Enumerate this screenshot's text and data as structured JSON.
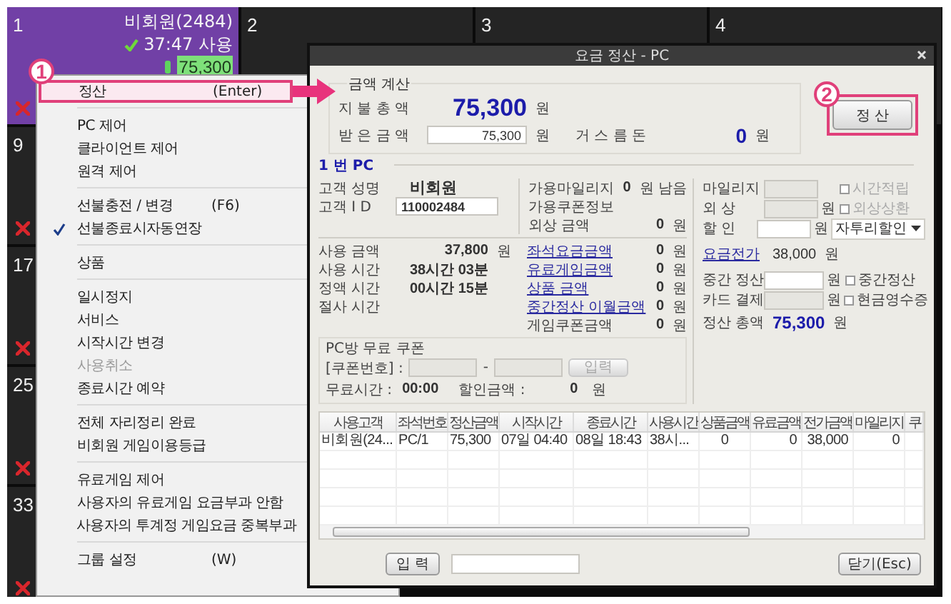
{
  "tile_rows": [
    [
      {
        "number": "1",
        "selected": true,
        "alert": true,
        "customer": "비회원(2484)",
        "time": "37:47 사용",
        "amount": "75,300"
      },
      {
        "number": "2",
        "selected": false
      },
      {
        "number": "3",
        "selected": false
      },
      {
        "number": "4",
        "selected": false
      }
    ],
    [
      {
        "number": "9",
        "selected": false,
        "alert": true
      }
    ],
    [
      {
        "number": "17",
        "selected": false,
        "alert": true
      }
    ],
    [
      {
        "number": "25",
        "selected": false,
        "alert": true
      }
    ],
    [
      {
        "number": "33",
        "selected": false,
        "alert": true
      }
    ]
  ],
  "context_menu": {
    "items": [
      {
        "kind": "item",
        "label": "정산",
        "shortcut": "(Enter)",
        "selected": true,
        "checked": false,
        "disabled": false
      },
      {
        "kind": "separator"
      },
      {
        "kind": "item",
        "label": "PC 제어",
        "selected": false,
        "checked": false,
        "disabled": false
      },
      {
        "kind": "item",
        "label": "클라이언트 제어",
        "selected": false,
        "checked": false,
        "disabled": false
      },
      {
        "kind": "item",
        "label": "원격 제어",
        "selected": false,
        "checked": false,
        "disabled": false
      },
      {
        "kind": "separator"
      },
      {
        "kind": "item",
        "label": "선불충전 / 변경",
        "shortcut": "(F6)",
        "selected": false,
        "checked": false,
        "disabled": false
      },
      {
        "kind": "item",
        "label": "선불종료시자동연장",
        "selected": false,
        "checked": true,
        "disabled": false
      },
      {
        "kind": "separator"
      },
      {
        "kind": "item",
        "label": "상품",
        "selected": false,
        "checked": false,
        "disabled": false
      },
      {
        "kind": "separator"
      },
      {
        "kind": "item",
        "label": "일시정지",
        "selected": false,
        "checked": false,
        "disabled": false
      },
      {
        "kind": "item",
        "label": "서비스",
        "selected": false,
        "checked": false,
        "disabled": false
      },
      {
        "kind": "item",
        "label": "시작시간 변경",
        "selected": false,
        "checked": false,
        "disabled": false
      },
      {
        "kind": "item",
        "label": "사용취소",
        "selected": false,
        "checked": false,
        "disabled": true
      },
      {
        "kind": "item",
        "label": "종료시간 예약",
        "selected": false,
        "checked": false,
        "disabled": false
      },
      {
        "kind": "separator"
      },
      {
        "kind": "item",
        "label": "전체 자리정리 완료",
        "selected": false,
        "checked": false,
        "disabled": false
      },
      {
        "kind": "item",
        "label": "비회원 게임이용등급",
        "selected": false,
        "checked": false,
        "disabled": false
      },
      {
        "kind": "separator"
      },
      {
        "kind": "item",
        "label": "유료게임 제어",
        "selected": false,
        "checked": false,
        "disabled": false
      },
      {
        "kind": "item",
        "label": "사용자의 유료게임 요금부과 안함",
        "selected": false,
        "checked": false,
        "disabled": false
      },
      {
        "kind": "item",
        "label": "사용자의 투계정 게임요금 중복부과",
        "selected": false,
        "checked": false,
        "disabled": false
      },
      {
        "kind": "separator"
      },
      {
        "kind": "item",
        "label": "그룹 설정",
        "shortcut": "(W)",
        "selected": false,
        "checked": false,
        "disabled": false
      }
    ]
  },
  "callouts": [
    {
      "label": "1"
    },
    {
      "label": "2"
    }
  ],
  "dialog": {
    "title": "요금 정산 - PC",
    "amount_group": {
      "legend": "금액 계산",
      "total_label": "지 불 총 액",
      "total": "75,300",
      "total_unit": "원",
      "received_label": "받 은 금 액",
      "received": "75,300",
      "received_unit": "원",
      "change_label": "거 스 름 돈",
      "change": "0",
      "change_unit": "원"
    },
    "settle_button": "정 산",
    "pc_label": "1 번 PC",
    "customer_rows": [
      {
        "kind": "text",
        "label": "고객 성명",
        "value": "비회원"
      },
      {
        "kind": "field",
        "label": "고객 I D",
        "value": "110002484"
      }
    ],
    "balance_rows": [
      {
        "label": "가용마일리지",
        "value": "0",
        "unit": "원 남음"
      },
      {
        "label": "가용쿠폰정보"
      },
      {
        "label": "외상 금액",
        "value": "0",
        "unit": "원"
      }
    ],
    "usage_rows": [
      {
        "label": "사용 금액",
        "value": "37,800",
        "unit": "원"
      },
      {
        "label": "사용 시간",
        "value": "38시간 03분"
      },
      {
        "label": "정액 시간",
        "value": "00시간 15분"
      },
      {
        "label": "절사 시간"
      }
    ],
    "charge_rows": [
      {
        "label": "좌석요금금액",
        "link": true,
        "value": "0",
        "unit": "원"
      },
      {
        "label": "유료게임금액",
        "link": true,
        "value": "0",
        "unit": "원"
      },
      {
        "label": "상품 금액",
        "link": true,
        "value": "0",
        "unit": "원"
      },
      {
        "label": "중간정산 이월금액",
        "link": true,
        "value": "0",
        "unit": "원"
      },
      {
        "label": "게임쿠폰금액",
        "link": false,
        "value": "0",
        "unit": "원"
      }
    ],
    "coupon": {
      "title": "PC방 무료 쿠폰",
      "code_label": "[쿠폰번호] :",
      "dash": "-",
      "enter_button": "입력",
      "enter_disabled": true,
      "free_time_label": "무료시간 :",
      "free_time": "00:00",
      "discount_label": "할인금액 :",
      "discount": "0",
      "discount_unit": "원"
    },
    "side_rows": [
      {
        "kind": "field",
        "label": "마일리지",
        "disabled": true,
        "checkbox": {
          "label": "시간적립",
          "checked": false,
          "disabled": true
        }
      },
      {
        "kind": "field",
        "label": "외 상",
        "unit": "원",
        "disabled": true,
        "checkbox": {
          "label": "외상상환",
          "checked": false,
          "disabled": true
        }
      },
      {
        "kind": "field",
        "label": "할 인",
        "unit": "원",
        "disabled": false,
        "dropdown": "자투리할인"
      },
      {
        "kind": "text",
        "label": "요금전가",
        "link": true,
        "value": "38,000",
        "unit": "원"
      },
      {
        "kind": "field",
        "label": "중간 정산",
        "unit": "원",
        "disabled": false,
        "checkbox": {
          "label": "중간정산",
          "checked": false,
          "disabled": false
        }
      },
      {
        "kind": "field",
        "label": "카드 결제",
        "unit": "원",
        "disabled": true,
        "checkbox": {
          "label": "현금영수증",
          "checked": false,
          "disabled": false
        }
      },
      {
        "kind": "total",
        "label": "정산 총액",
        "value": "75,300",
        "unit": "원"
      }
    ],
    "table": {
      "columns": [
        "사용고객",
        "좌석번호",
        "정산금액",
        "시작시간",
        "종료시간",
        "사용시간",
        "상품금액",
        "유료금액",
        "전가금액",
        "마일리지",
        "쿠"
      ],
      "rows": [
        [
          "비회원(24...",
          "PC/1",
          "75,300",
          "07일 04:40",
          "08일 18:43",
          "38시...",
          "0",
          "0",
          "38,000",
          "0"
        ]
      ]
    },
    "input_button": "입 력",
    "close_button": "닫기(Esc)"
  }
}
